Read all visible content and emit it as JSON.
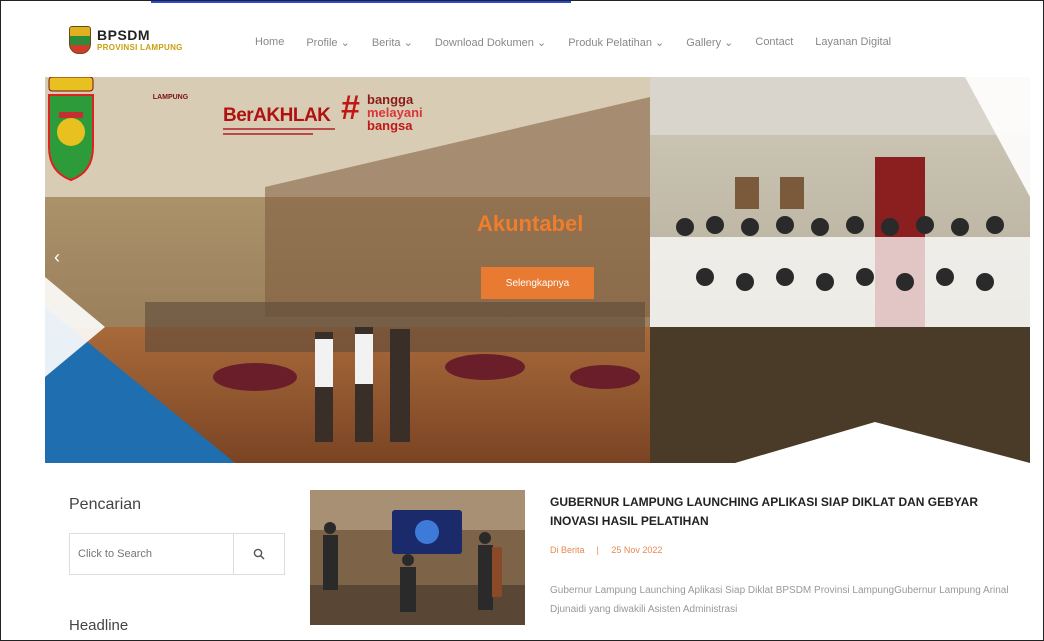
{
  "header": {
    "logo_title": "BPSDM",
    "logo_subtitle": "PROVINSI LAMPUNG",
    "nav": [
      "Home",
      "Profile",
      "Berita",
      "Download Dokumen",
      "Produk Pelatihan",
      "Gallery",
      "Contact",
      "Layanan Digital"
    ],
    "nav_has_dropdown": [
      false,
      true,
      true,
      true,
      true,
      true,
      false,
      false
    ]
  },
  "hero": {
    "caption": "Akuntabel",
    "button_label": "Selengkapnya",
    "prev_icon": "chevron-left-icon",
    "province_label": "LAMPUNG",
    "brand_berakhlak": "BerAKHLAK",
    "brand_bangga": [
      "bangga",
      "melayani",
      "bangsa"
    ]
  },
  "sidebar": {
    "search_title": "Pencarian",
    "search_placeholder": "Click to Search",
    "search_icon": "search-icon",
    "headline_title": "Headline"
  },
  "news": {
    "title": "GUBERNUR LAMPUNG LAUNCHING APLIKASI SIAP DIKLAT DAN GEBYAR INOVASI HASIL PELATIHAN",
    "category": "Di Berita",
    "date": "25 Nov 2022",
    "excerpt": "Gubernur Lampung Launching Aplikasi Siap Diklat BPSDM Provinsi LampungGubernur Lampung Arinal Djunaidi yang diwakili Asisten Administrasi"
  },
  "colors": {
    "accent": "#e97a31",
    "nav_text": "#888888",
    "logo_gold": "#c8a010",
    "hero_blue": "#1f6fb0"
  }
}
